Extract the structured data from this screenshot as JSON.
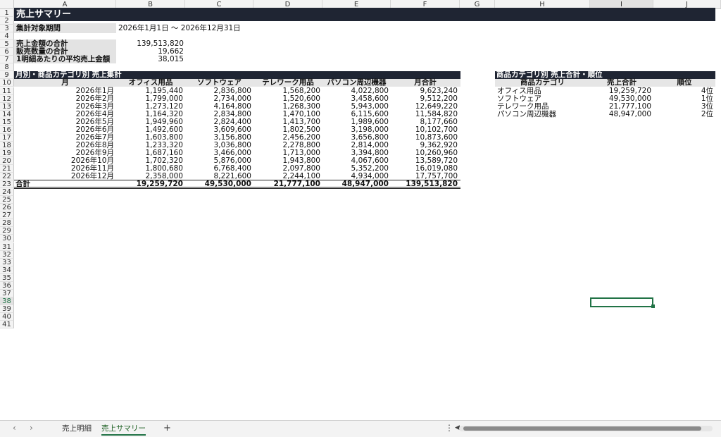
{
  "columns": [
    "A",
    "B",
    "C",
    "D",
    "E",
    "F",
    "G",
    "H",
    "I",
    "J"
  ],
  "rows_count": 41,
  "selected_cell": {
    "col": "I",
    "row": 38
  },
  "title": "売上サマリー",
  "period": {
    "label": "集計対象期間",
    "value": "2026年1月1日 ～ 2026年12月31日"
  },
  "kpis": [
    {
      "label": "売上金額の合計",
      "value": "139,513,820"
    },
    {
      "label": "販売数量の合計",
      "value": "19,662"
    },
    {
      "label": "1明細あたりの平均売上金額",
      "value": "38,015"
    }
  ],
  "monthly": {
    "section_title": "月別・商品カテゴリ別 売上集計",
    "headers": [
      "月",
      "オフィス用品",
      "ソフトウェア",
      "テレワーク用品",
      "パソコン周辺機器",
      "月合計"
    ],
    "rows": [
      [
        "2026年1月",
        "1,195,440",
        "2,836,800",
        "1,568,200",
        "4,022,800",
        "9,623,240"
      ],
      [
        "2026年2月",
        "1,799,000",
        "2,734,000",
        "1,520,600",
        "3,458,600",
        "9,512,200"
      ],
      [
        "2026年3月",
        "1,273,120",
        "4,164,800",
        "1,268,300",
        "5,943,000",
        "12,649,220"
      ],
      [
        "2026年4月",
        "1,164,320",
        "2,834,800",
        "1,470,100",
        "6,115,600",
        "11,584,820"
      ],
      [
        "2026年5月",
        "1,949,960",
        "2,824,400",
        "1,413,700",
        "1,989,600",
        "8,177,660"
      ],
      [
        "2026年6月",
        "1,492,600",
        "3,609,600",
        "1,802,500",
        "3,198,000",
        "10,102,700"
      ],
      [
        "2026年7月",
        "1,603,800",
        "3,156,800",
        "2,456,200",
        "3,656,800",
        "10,873,600"
      ],
      [
        "2026年8月",
        "1,233,320",
        "3,036,800",
        "2,278,800",
        "2,814,000",
        "9,362,920"
      ],
      [
        "2026年9月",
        "1,687,160",
        "3,466,000",
        "1,713,000",
        "3,394,800",
        "10,260,960"
      ],
      [
        "2026年10月",
        "1,702,320",
        "5,876,000",
        "1,943,800",
        "4,067,600",
        "13,589,720"
      ],
      [
        "2026年11月",
        "1,800,680",
        "6,768,400",
        "2,097,800",
        "5,352,200",
        "16,019,080"
      ],
      [
        "2026年12月",
        "2,358,000",
        "8,221,600",
        "2,244,100",
        "4,934,000",
        "17,757,700"
      ]
    ],
    "total": [
      "合計",
      "19,259,720",
      "49,530,000",
      "21,777,100",
      "48,947,000",
      "139,513,820"
    ]
  },
  "ranking": {
    "section_title": "商品カテゴリ別 売上合計・順位",
    "headers": [
      "商品カテゴリ",
      "売上合計",
      "順位"
    ],
    "rows": [
      [
        "オフィス用品",
        "19,259,720",
        "4位"
      ],
      [
        "ソフトウェア",
        "49,530,000",
        "1位"
      ],
      [
        "テレワーク用品",
        "21,777,100",
        "3位"
      ],
      [
        "パソコン周辺機器",
        "48,947,000",
        "2位"
      ]
    ]
  },
  "sheet_tabs": [
    {
      "label": "売上明細",
      "active": false
    },
    {
      "label": "売上サマリー",
      "active": true
    }
  ],
  "add_sheet_label": "+",
  "nav_prev": "‹",
  "nav_next": "›",
  "tab_menu": "⋮",
  "scroll_left": "◀",
  "colors": {
    "band": "#1f2533",
    "accent": "#217346",
    "label_bg": "#e3e3e3"
  }
}
